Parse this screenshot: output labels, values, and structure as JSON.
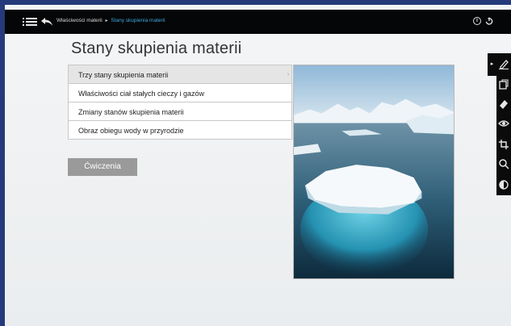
{
  "header": {
    "breadcrumb": [
      "Właściwości materii",
      "Stany skupienia materii"
    ],
    "separator": "▸",
    "icons": [
      "menu-icon",
      "back-icon",
      "info-icon",
      "power-icon"
    ],
    "info_label": "i"
  },
  "main": {
    "title": "Stany skupienia materii",
    "menu": [
      {
        "label": "Trzy stany skupienia materii",
        "active": true
      },
      {
        "label": "Właściwości ciał stałych cieczy i gazów",
        "active": false
      },
      {
        "label": "Zmiany stanów skupienia materii",
        "active": false
      },
      {
        "label": "Obraz obiegu wody w przyrodzie",
        "active": false
      }
    ],
    "active_chevron": "›",
    "exercise_button": "Ćwiczenia",
    "image": {
      "subject": "iceberg-photo"
    }
  },
  "toolbar": {
    "toggle": "▸",
    "icons": [
      "pencil-icon",
      "copy-icon",
      "eraser-icon",
      "eye-icon",
      "crop-icon",
      "search-icon",
      "contrast-icon"
    ]
  },
  "colors": {
    "outer": "#243a7a",
    "topbar": "#050607",
    "breadcrumb_current": "#3fa8e0",
    "button": "#9a9a9a"
  }
}
